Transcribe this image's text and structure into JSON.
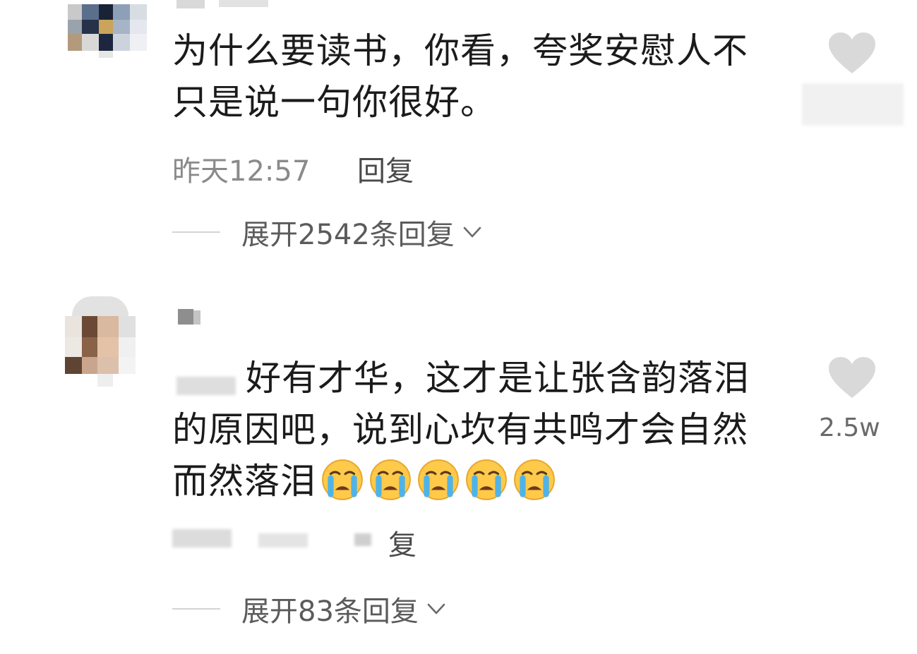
{
  "comments": [
    {
      "text_lines": [
        "为什么要读书，你看，夸奖安慰人不",
        "只是说一句你很好。"
      ],
      "time": "昨天12:57",
      "reply_label": "回复",
      "expand_label": "展开2542条回复",
      "like_count": ""
    },
    {
      "text_lines": [
        "好有才华，这才是让张含韵落泪",
        "的原因吧，说到心坎有共鸣才会自然",
        "而然落泪"
      ],
      "emoji_count": 5,
      "emoji_name": "loudly-crying-face",
      "reply_label": "复",
      "expand_label": "展开83条回复",
      "like_count": "2.5w"
    }
  ],
  "icons": {
    "like": "heart-icon",
    "expand": "chevron-down-icon"
  },
  "colors": {
    "heart": "#d9d9d9",
    "emoji_face": "#ffc94a",
    "emoji_tears": "#4fb3e8"
  }
}
